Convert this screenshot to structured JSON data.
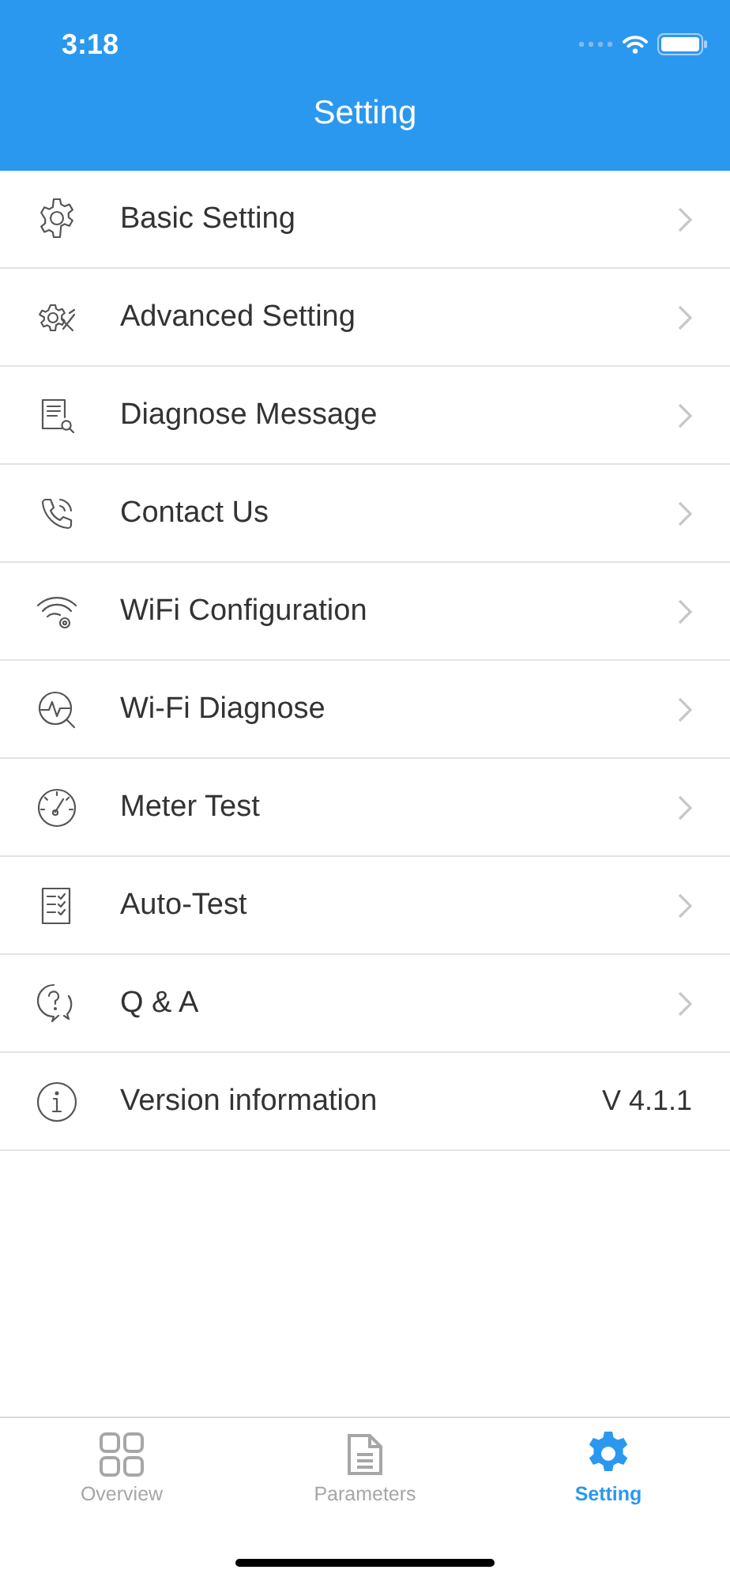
{
  "status_bar": {
    "time": "3:18"
  },
  "header": {
    "title": "Setting"
  },
  "menu": [
    {
      "kind": "link",
      "label": "Basic Setting"
    },
    {
      "kind": "link",
      "label": "Advanced Setting"
    },
    {
      "kind": "link",
      "label": "Diagnose Message"
    },
    {
      "kind": "link",
      "label": "Contact Us"
    },
    {
      "kind": "link",
      "label": "WiFi Configuration"
    },
    {
      "kind": "link",
      "label": "Wi-Fi Diagnose"
    },
    {
      "kind": "link",
      "label": "Meter Test"
    },
    {
      "kind": "link",
      "label": "Auto-Test"
    },
    {
      "kind": "link",
      "label": "Q & A"
    },
    {
      "kind": "value",
      "label": "Version information",
      "value": "V 4.1.1"
    }
  ],
  "tabs": [
    {
      "label": "Overview",
      "selected": false
    },
    {
      "label": "Parameters",
      "selected": false
    },
    {
      "label": "Setting",
      "selected": true
    }
  ]
}
